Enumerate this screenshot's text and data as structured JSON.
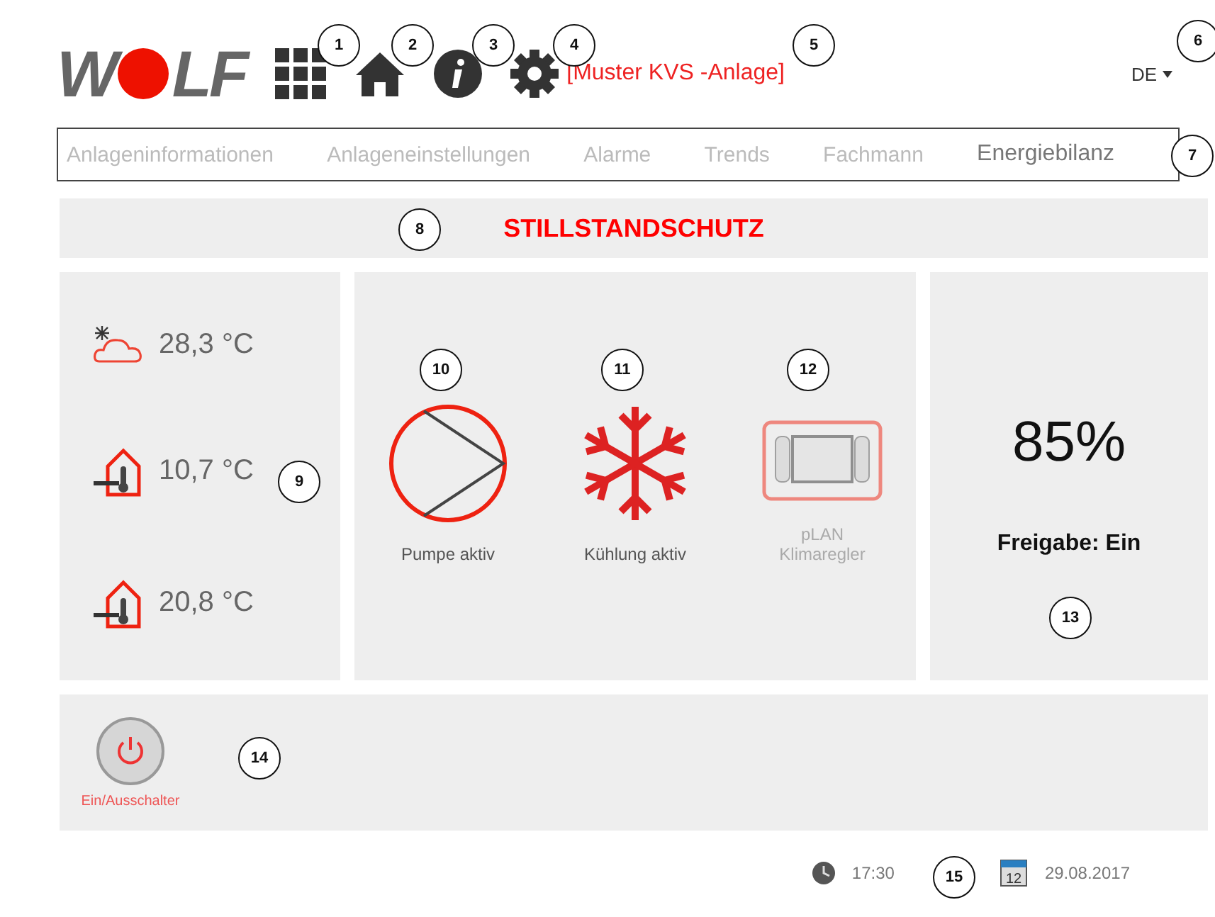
{
  "header": {
    "logo": [
      "W",
      "LF"
    ],
    "plant_name": "[Muster KVS -Anlage]",
    "language": "DE"
  },
  "nav_tabs": [
    {
      "label": "Anlageninformationen",
      "selected": false
    },
    {
      "label": "Anlageneinstellungen",
      "selected": false
    },
    {
      "label": "Alarme",
      "selected": false
    },
    {
      "label": "Trends",
      "selected": false
    },
    {
      "label": "Fachmann",
      "selected": false
    },
    {
      "label": "Energiebilanz",
      "selected": true
    }
  ],
  "status_banner": "STILLSTANDSCHUTZ",
  "temperatures": [
    {
      "kind": "outdoor",
      "value": "28,3 °C"
    },
    {
      "kind": "supply",
      "value": "10,7 °C"
    },
    {
      "kind": "room",
      "value": "20,8 °C"
    }
  ],
  "components": [
    {
      "kind": "pump",
      "label": "Pumpe aktiv",
      "active": true
    },
    {
      "kind": "cooling",
      "label": "Kühlung aktiv",
      "active": true
    },
    {
      "kind": "controller",
      "label": "pLAN Klimaregler",
      "active": false
    }
  ],
  "release": {
    "percent": "85%",
    "label": "Freigabe: Ein"
  },
  "power_switch": {
    "label": "Ein/Ausschalter"
  },
  "footer": {
    "time": "17:30",
    "calendar_day": "12",
    "date": "29.08.2017"
  },
  "callouts": [
    "1",
    "2",
    "3",
    "4",
    "5",
    "6",
    "7",
    "8",
    "9",
    "10",
    "11",
    "12",
    "13",
    "14",
    "15"
  ]
}
